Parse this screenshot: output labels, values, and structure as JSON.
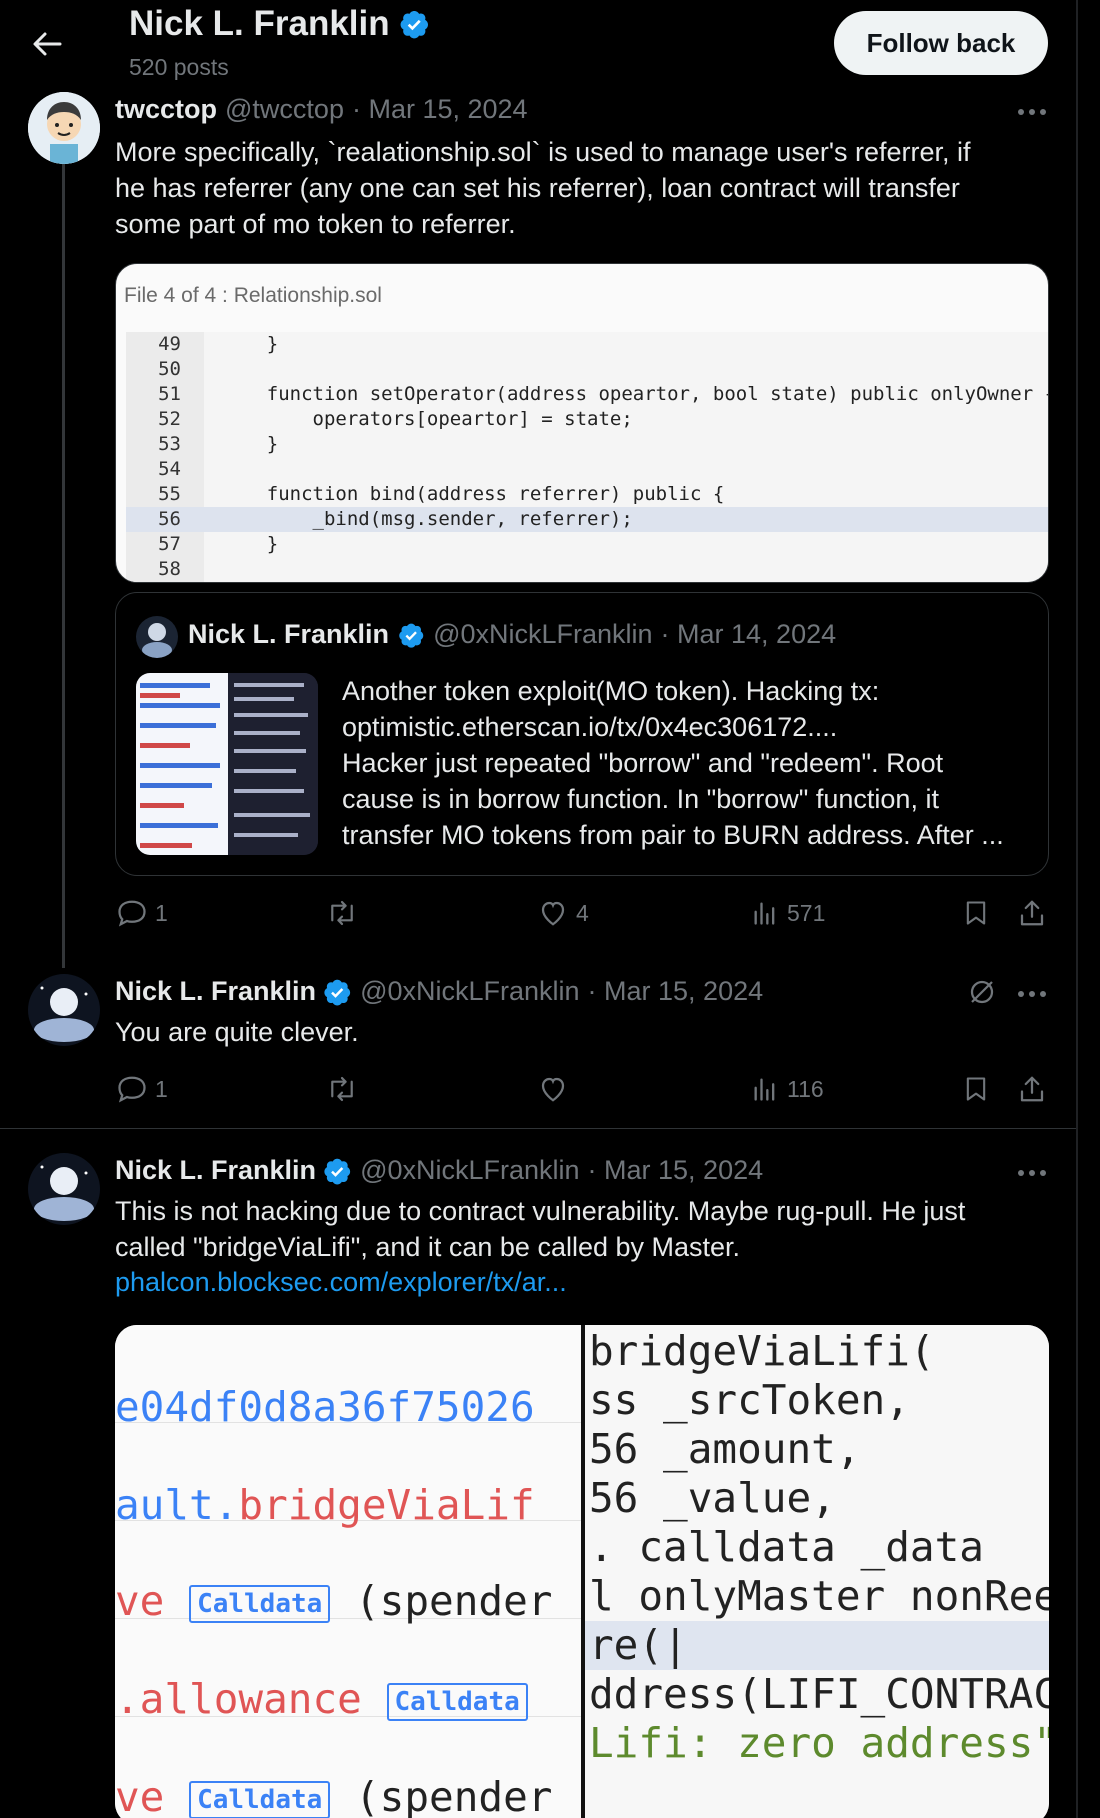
{
  "header": {
    "name": "Nick L. Franklin",
    "posts": "520 posts",
    "follow_label": "Follow back"
  },
  "colors": {
    "accent": "#1d9bf0",
    "verified": "#1d9bf0",
    "text": "#e7e9ea",
    "muted": "#71767b",
    "background": "#000000"
  },
  "tweet1": {
    "name": "twcctop",
    "handle": "@twcctop",
    "date": "· Mar 15, 2024",
    "text": [
      "More specifically,   `realationship.sol` is used to  manage user's referrer, if",
      "he has referrer (any one can set his referrer),   loan  contract  will transfer",
      "some part of   mo token to  referrer."
    ],
    "image": {
      "title": "File 4 of 4 : Relationship.sol",
      "lines": [
        {
          "n": "49",
          "code": "    }"
        },
        {
          "n": "50",
          "code": ""
        },
        {
          "n": "51",
          "code": "    function setOperator(address opeartor, bool state) public onlyOwner {"
        },
        {
          "n": "52",
          "code": "        operators[opeartor] = state;"
        },
        {
          "n": "53",
          "code": "    }"
        },
        {
          "n": "54",
          "code": ""
        },
        {
          "n": "55",
          "code": "    function bind(address referrer) public {"
        },
        {
          "n": "56",
          "code": "        _bind(msg.sender, referrer);"
        },
        {
          "n": "57",
          "code": "    }"
        },
        {
          "n": "58",
          "code": ""
        }
      ]
    },
    "quote": {
      "name": "Nick L. Franklin",
      "handle": "@0xNickLFranklin",
      "date": "· Mar 14, 2024",
      "text": [
        "Another token exploit(MO token). Hacking tx:",
        "optimistic.etherscan.io/tx/0x4ec306172....",
        "Hacker just repeated \"borrow\" and \"redeem\". Root",
        "cause is in borrow function. In \"borrow\" function, it",
        "transfer MO tokens from pair to BURN address. After ..."
      ]
    },
    "actions": {
      "replies": "1",
      "reposts": "",
      "likes": "4",
      "views": "571"
    }
  },
  "tweet2": {
    "name": "Nick L. Franklin",
    "handle": "@0xNickLFranklin",
    "date": "· Mar 15, 2024",
    "text": "You are quite clever.",
    "actions": {
      "replies": "1",
      "reposts": "",
      "likes": "",
      "views": "116"
    }
  },
  "tweet3": {
    "name": "Nick L. Franklin",
    "handle": "@0xNickLFranklin",
    "date": "· Mar 15, 2024",
    "text": [
      "This is not hacking due to contract vulnerability. Maybe rug-pull. He just",
      "called \"bridgeViaLifi\", and it can be called by Master."
    ],
    "link": "phalcon.blocksec.com/explorer/tx/ar...",
    "image_left": {
      "rows": [
        "e04df0d8a36f75026",
        "ault.bridgeViaLif",
        "ve",
        ".allowance",
        "ve"
      ],
      "badge": "Calldata",
      "spender": "(spender"
    },
    "image_right": {
      "lines": [
        "bridgeViaLifi(",
        "ss _srcToken,",
        "56 _amount,",
        "56 _value,",
        ". calldata _data",
        "l onlyMaster nonReen",
        "re(|",
        "ddress(LIFI_CONTRACT",
        "Lifi: zero address\""
      ]
    }
  }
}
